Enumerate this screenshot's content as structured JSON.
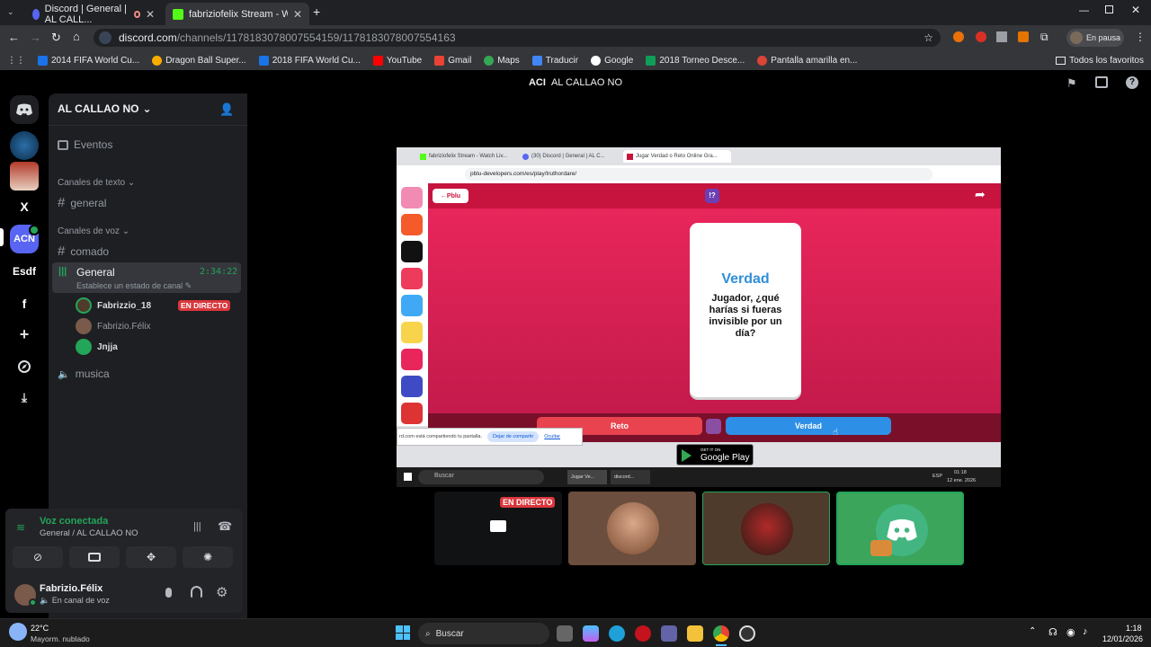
{
  "browser": {
    "tabs": [
      {
        "label": "Discord | General | AL CALL..."
      },
      {
        "label": "fabriziofelix Stream - Watch Live..."
      }
    ],
    "url_host": "discord.com",
    "url_path": "/channels/1178183078007554159/1178183078007554163",
    "profile": "En pausa",
    "bookmarks": [
      "2014 FIFA World Cu...",
      "Dragon Ball Super...",
      "2018 FIFA World Cu...",
      "YouTube",
      "Gmail",
      "Maps",
      "Traducir",
      "Google",
      "2018 Torneo Desce...",
      "Pantalla amarilla en..."
    ],
    "all_bookmarks": "Todos los favoritos"
  },
  "discord": {
    "title_prefix": "ACI",
    "title": "AL CALLAO NO",
    "server_name": "AL CALLAO NO",
    "events": "Eventos",
    "text_category": "Canales de texto",
    "voice_category": "Canales de voz",
    "channels": {
      "general": "general",
      "comado": "comado",
      "voice_general": "General",
      "timer": "2:34:22",
      "status": "Establece un estado de canal",
      "musica": "musica"
    },
    "voice_users": [
      {
        "name": "Fabrizzio_18",
        "badge": "EN DIRECTO"
      },
      {
        "name": "Fabrizio.Félix"
      },
      {
        "name": "Jnjja"
      }
    ],
    "guild_labels": {
      "x": "X",
      "acn": "ACN",
      "esdf": "Esdf",
      "f": "f"
    },
    "voice_connected": "Voz conectada",
    "voice_location": "General / AL CALLAO NO",
    "user_name": "Fabrizio.Félix",
    "user_status": "En canal de voz",
    "live_badge": "EN DIRECTO"
  },
  "shared": {
    "tabs": [
      "fabriziofelix Stream - Watch Liv...",
      "(30) Discord | General | AL C...",
      "Jugar Verdad o Reto Online Gra..."
    ],
    "url": "pblu-developers.com/es/play/truthordare/",
    "back": "Pblu",
    "card_title": "Verdad",
    "card_text": "Jugador, ¿qué harías si fueras invisible por un día?",
    "btn_reto": "Reto",
    "btn_verdad": "Verdad",
    "play_small": "GET IT ON",
    "play_big": "Google Play",
    "share_msg": "rd.com está compartiendo tu pantalla.",
    "stop_share": "Dejar de compartir",
    "hide": "Ocultar",
    "search": "Buscar",
    "tb_items": [
      "Jugar Ve...",
      "discord..."
    ],
    "lang": "ESP",
    "time": "01:18",
    "date": "12 ene. 2026"
  },
  "taskbar": {
    "temp": "22°C",
    "weather": "Mayorm. nublado",
    "search": "Buscar",
    "time": "1:18",
    "date": "12/01/2026"
  },
  "colors": {
    "discord_green": "#23a55a",
    "live_red": "#da373c",
    "blurple": "#5865f2",
    "game_pink": "#e8265b"
  }
}
